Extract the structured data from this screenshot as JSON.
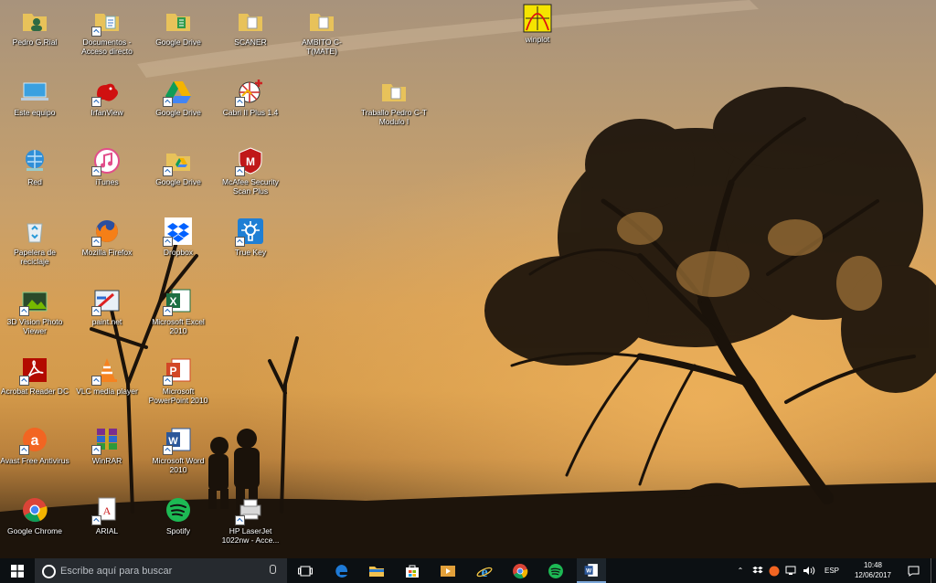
{
  "desktop": {
    "icons": [
      {
        "label": "Pedro G.Rial",
        "icon": "user-folder-icon"
      },
      {
        "label": "Documentos - Acceso directo",
        "icon": "documents-folder-icon"
      },
      {
        "label": "Google Drive",
        "icon": "google-drive-folder-icon"
      },
      {
        "label": "SCANER",
        "icon": "folder-icon"
      },
      {
        "label": "AMBITO C-T(MATE)",
        "icon": "folder-icon"
      },
      {
        "label": "winplot",
        "icon": "winplot-icon"
      },
      {
        "label": "Este equipo",
        "icon": "this-pc-icon"
      },
      {
        "label": "IrfanView",
        "icon": "irfanview-icon"
      },
      {
        "label": "Google Drive",
        "icon": "google-drive-icon"
      },
      {
        "label": "Cabri II Plus 1.4",
        "icon": "cabri-icon"
      },
      {
        "label": "Traballo Pedro C-T Modulo I",
        "icon": "folder-icon"
      },
      {
        "label": "Red",
        "icon": "network-icon"
      },
      {
        "label": "iTunes",
        "icon": "itunes-icon"
      },
      {
        "label": "Google Drive",
        "icon": "google-drive-folder-icon"
      },
      {
        "label": "McAfee Security Scan Plus",
        "icon": "mcafee-icon"
      },
      {
        "label": "Papelera de reciclaje",
        "icon": "recycle-bin-icon"
      },
      {
        "label": "Mozilla Firefox",
        "icon": "firefox-icon"
      },
      {
        "label": "Dropbox",
        "icon": "dropbox-icon"
      },
      {
        "label": "True Key",
        "icon": "truekey-icon"
      },
      {
        "label": "3D Vision Photo Viewer",
        "icon": "3d-vision-icon"
      },
      {
        "label": "paint.net",
        "icon": "paintnet-icon"
      },
      {
        "label": "Microsoft Excel 2010",
        "icon": "excel-icon"
      },
      {
        "label": "Acrobat Reader DC",
        "icon": "acrobat-icon"
      },
      {
        "label": "VLC media player",
        "icon": "vlc-icon"
      },
      {
        "label": "Microsoft PowerPoint 2010",
        "icon": "powerpoint-icon"
      },
      {
        "label": "Avast Free Antivirus",
        "icon": "avast-icon"
      },
      {
        "label": "WinRAR",
        "icon": "winrar-icon"
      },
      {
        "label": "Microsoft Word 2010",
        "icon": "word-icon"
      },
      {
        "label": "Google Chrome",
        "icon": "chrome-icon"
      },
      {
        "label": "ARIAL",
        "icon": "font-file-icon"
      },
      {
        "label": "Spotify",
        "icon": "spotify-icon"
      },
      {
        "label": "HP LaserJet 1022nw - Acce...",
        "icon": "printer-icon"
      }
    ]
  },
  "taskbar": {
    "search_placeholder": "Escribe aquí para buscar",
    "pinned": [
      "task-view-icon",
      "edge-icon",
      "file-explorer-icon",
      "store-icon",
      "media-player-icon",
      "internet-explorer-icon",
      "chrome-icon",
      "spotify-icon",
      "word-icon"
    ],
    "language": "ESP",
    "time": "10:48",
    "date": "12/06/2017"
  },
  "colors": {
    "taskbar": "#0c1013",
    "search_box": "#262a2f",
    "accent": "#1a73e8"
  }
}
